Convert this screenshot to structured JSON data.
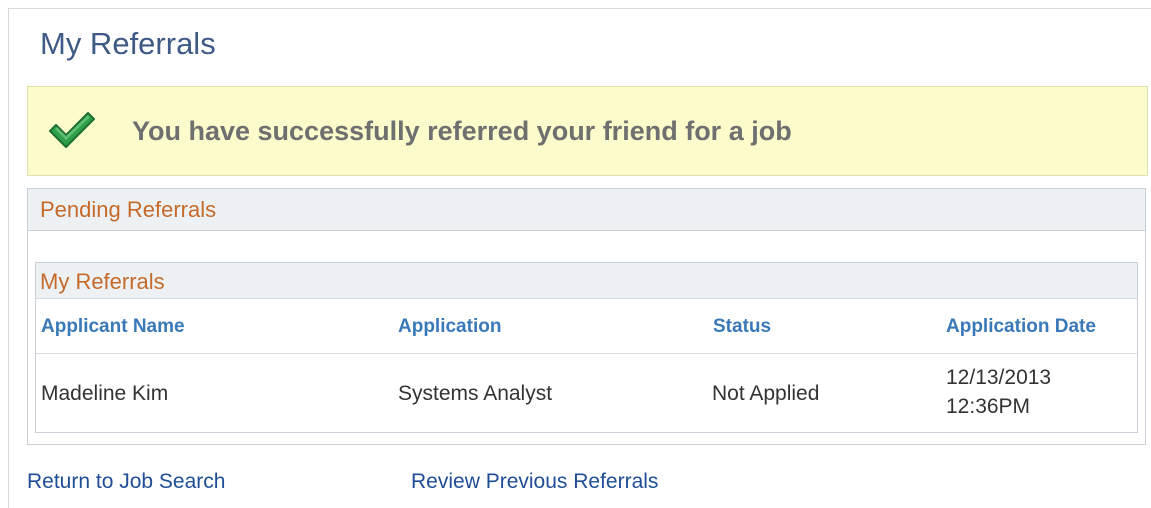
{
  "page": {
    "title": "My Referrals"
  },
  "banner": {
    "icon": "checkmark-icon",
    "message": "You have successfully referred your friend for a job"
  },
  "pending": {
    "title": "Pending Referrals",
    "grid": {
      "title": "My Referrals",
      "columns": [
        "Applicant Name",
        "Application",
        "Status",
        "Application Date"
      ],
      "rows": [
        {
          "applicant_name": "Madeline Kim",
          "application": "Systems Analyst",
          "status": "Not Applied",
          "date": "12/13/2013",
          "time": "12:36PM"
        }
      ]
    }
  },
  "links": {
    "return_to_search": "Return to Job Search",
    "review_previous": "Review Previous Referrals"
  },
  "colors": {
    "title": "#3e5a85",
    "banner_bg": "#fbfbcb",
    "section_title": "#c56a2a",
    "column_header": "#3a79b8",
    "link": "#1f4e96"
  }
}
